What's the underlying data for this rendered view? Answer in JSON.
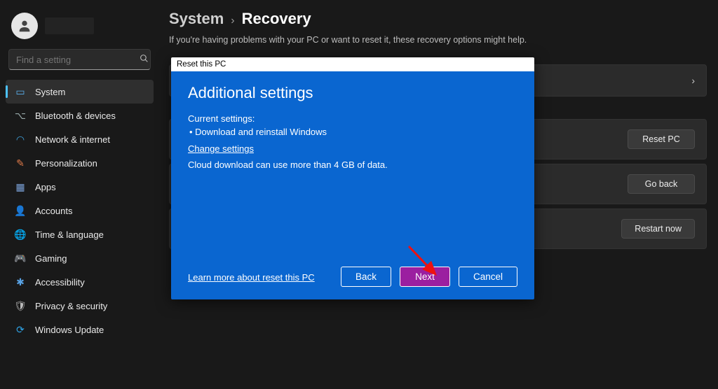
{
  "sidebar": {
    "search_placeholder": "Find a setting",
    "items": [
      {
        "label": "System"
      },
      {
        "label": "Bluetooth & devices"
      },
      {
        "label": "Network & internet"
      },
      {
        "label": "Personalization"
      },
      {
        "label": "Apps"
      },
      {
        "label": "Accounts"
      },
      {
        "label": "Time & language"
      },
      {
        "label": "Gaming"
      },
      {
        "label": "Accessibility"
      },
      {
        "label": "Privacy & security"
      },
      {
        "label": "Windows Update"
      }
    ]
  },
  "breadcrumb": {
    "parent": "System",
    "sep": "›",
    "page": "Recovery"
  },
  "main": {
    "subhead": "If you're having problems with your PC or want to reset it, these recovery options might help.",
    "buttons": {
      "reset": "Reset PC",
      "goback": "Go back",
      "restart": "Restart now"
    }
  },
  "dialog": {
    "titlebar": "Reset this PC",
    "heading": "Additional settings",
    "current_label": "Current settings:",
    "current_items": [
      "Download and reinstall Windows"
    ],
    "change_link": "Change settings",
    "note": "Cloud download can use more than 4 GB of data.",
    "learn_link": "Learn more about reset this PC",
    "back": "Back",
    "next": "Next",
    "cancel": "Cancel"
  }
}
